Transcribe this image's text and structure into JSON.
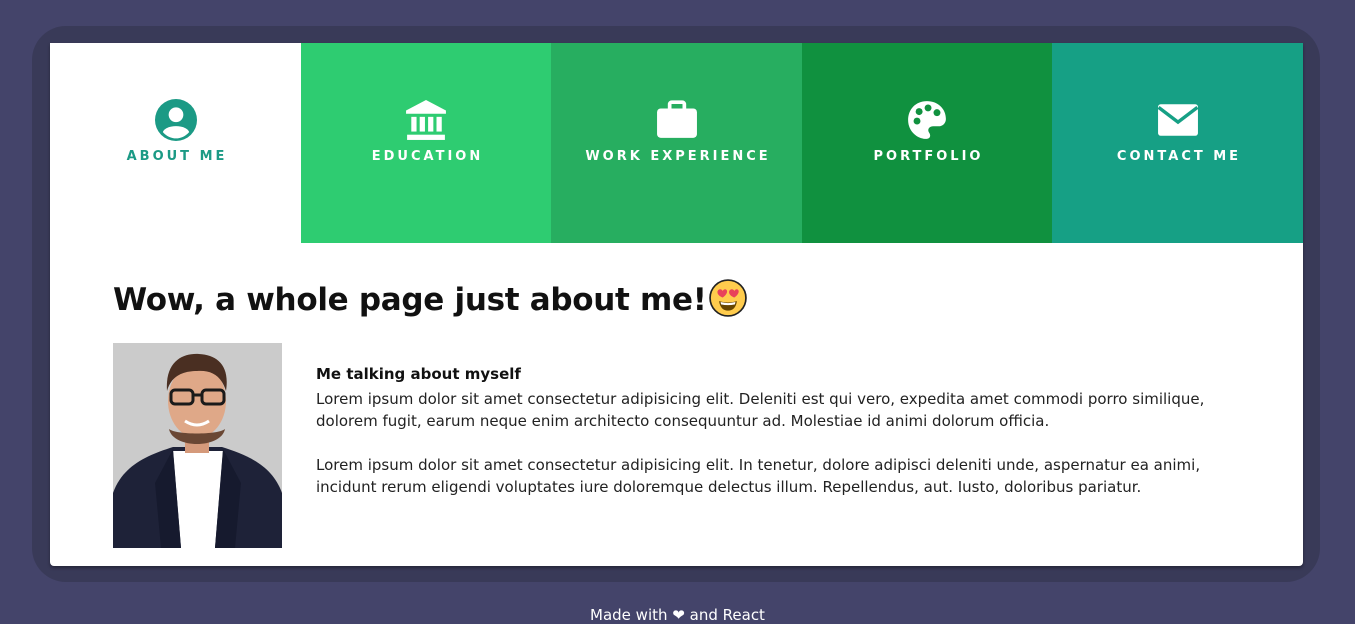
{
  "colors": {
    "page_bg": "#44446a",
    "frame_bg": "#393a58",
    "tab_about": "#ffffff",
    "tab_education": "#2ecc71",
    "tab_work": "#27ae60",
    "tab_portfolio": "#10913f",
    "tab_contact": "#16a085",
    "accent": "#1b9a85"
  },
  "nav": {
    "tabs": [
      {
        "label": "ABOUT ME",
        "icon": "user-circle-icon",
        "active": true
      },
      {
        "label": "EDUCATION",
        "icon": "bank-icon",
        "active": false
      },
      {
        "label": "WORK EXPERIENCE",
        "icon": "briefcase-icon",
        "active": false
      },
      {
        "label": "PORTFOLIO",
        "icon": "palette-icon",
        "active": false
      },
      {
        "label": "CONTACT ME",
        "icon": "envelope-icon",
        "active": false
      }
    ]
  },
  "about": {
    "title": "Wow, a whole page just about me!",
    "title_emoji": "heart-eyes-emoji",
    "photo": "profile-photo",
    "subtitle": "Me talking about myself",
    "paragraphs": [
      "Lorem ipsum dolor sit amet consectetur adipisicing elit. Deleniti est qui vero, expedita amet commodi porro similique, dolorem fugit, earum neque enim architecto consequuntur ad. Molestiae id animi dolorum officia.",
      "Lorem ipsum dolor sit amet consectetur adipisicing elit. In tenetur, dolore adipisci deleniti unde, aspernatur ea animi, incidunt rerum eligendi voluptates iure doloremque delectus illum. Repellendus, aut. Iusto, doloribus pariatur."
    ]
  },
  "footer": {
    "text_before": "Made with",
    "heart": "❤",
    "text_after": "and React"
  }
}
